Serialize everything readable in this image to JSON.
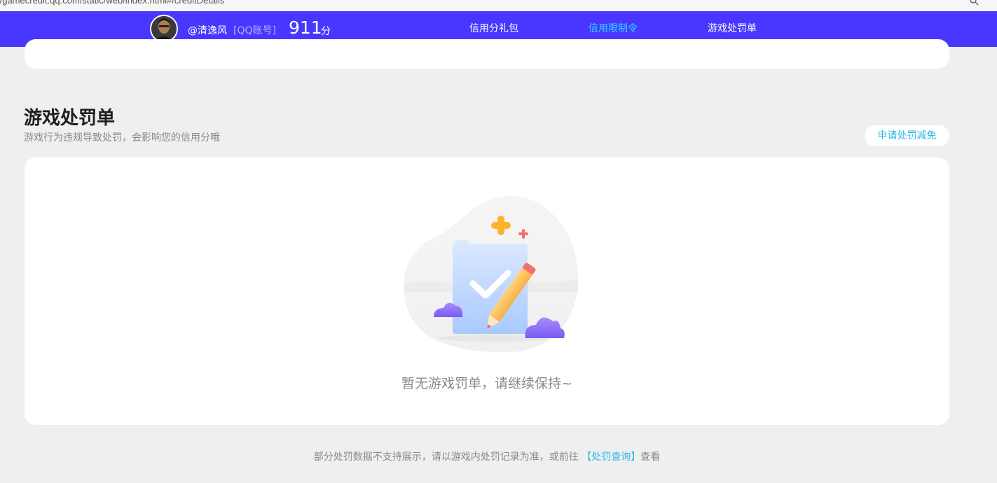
{
  "browser": {
    "url": "//gamecredit.qq.com/static/web/index.html#/creditDetails"
  },
  "nav": {
    "username": "@清逸风",
    "account_type": "[QQ账号]",
    "score": "911",
    "score_unit": "分",
    "tabs": [
      {
        "label": "信用分礼包",
        "active": false
      },
      {
        "label": "信用限制令",
        "active": true
      },
      {
        "label": "游戏处罚单",
        "active": false
      }
    ],
    "colors": {
      "background": "#4a37ff",
      "active_tab": "#2fdcff"
    }
  },
  "section": {
    "title": "游戏处罚单",
    "subtitle": "游戏行为违规导致处罚，会影响您的信用分哦",
    "appeal_button": "申请处罚减免"
  },
  "empty_state": {
    "message": "暂无游戏罚单，请继续保持~",
    "icon": "document-check-pencil-illustration"
  },
  "footer": {
    "prefix": "部分处罚数据不支持展示，请以游戏内处罚记录为准，或前往",
    "link": "【处罚查询】",
    "suffix": "查看"
  }
}
